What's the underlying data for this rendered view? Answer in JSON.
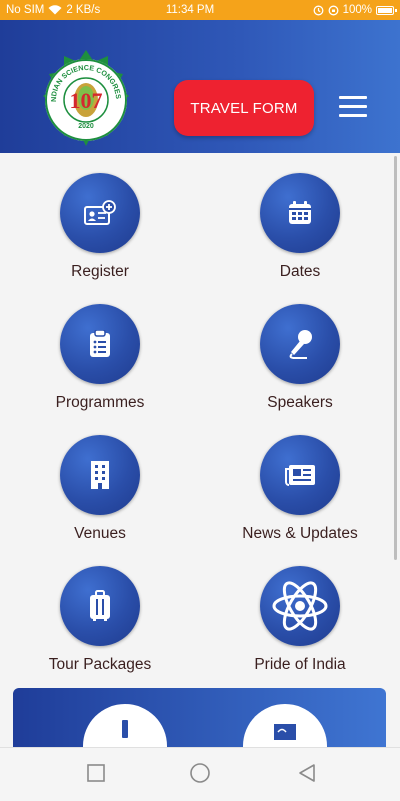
{
  "status_bar": {
    "carrier": "No SIM",
    "speed": "2 KB/s",
    "time": "11:34 PM",
    "battery_percent": "100%"
  },
  "header": {
    "logo_text": "INDIAN SCIENCE CONGRESS",
    "logo_number": "107",
    "logo_year": "2020",
    "travel_button": "TRAVEL FORM",
    "menu_icon": "hamburger-menu-icon"
  },
  "tiles": [
    {
      "label": "Register",
      "icon": "id-card-plus-icon"
    },
    {
      "label": "Dates",
      "icon": "calendar-icon"
    },
    {
      "label": "Programmes",
      "icon": "clipboard-list-icon"
    },
    {
      "label": "Speakers",
      "icon": "microphone-icon"
    },
    {
      "label": "Venues",
      "icon": "building-icon"
    },
    {
      "label": "News & Updates",
      "icon": "newspaper-icon"
    },
    {
      "label": "Tour Packages",
      "icon": "luggage-icon"
    },
    {
      "label": "Pride of India",
      "icon": "atom-icon"
    }
  ],
  "colors": {
    "status_bar": "#f5a31a",
    "header_start": "#1f3d99",
    "header_end": "#3d73cf",
    "travel_button": "#ee2230",
    "icon_circle": "#2a4ea9",
    "label_text": "#3a1f1f"
  },
  "nav_bar": [
    "square-recents-icon",
    "circle-home-icon",
    "triangle-back-icon"
  ]
}
